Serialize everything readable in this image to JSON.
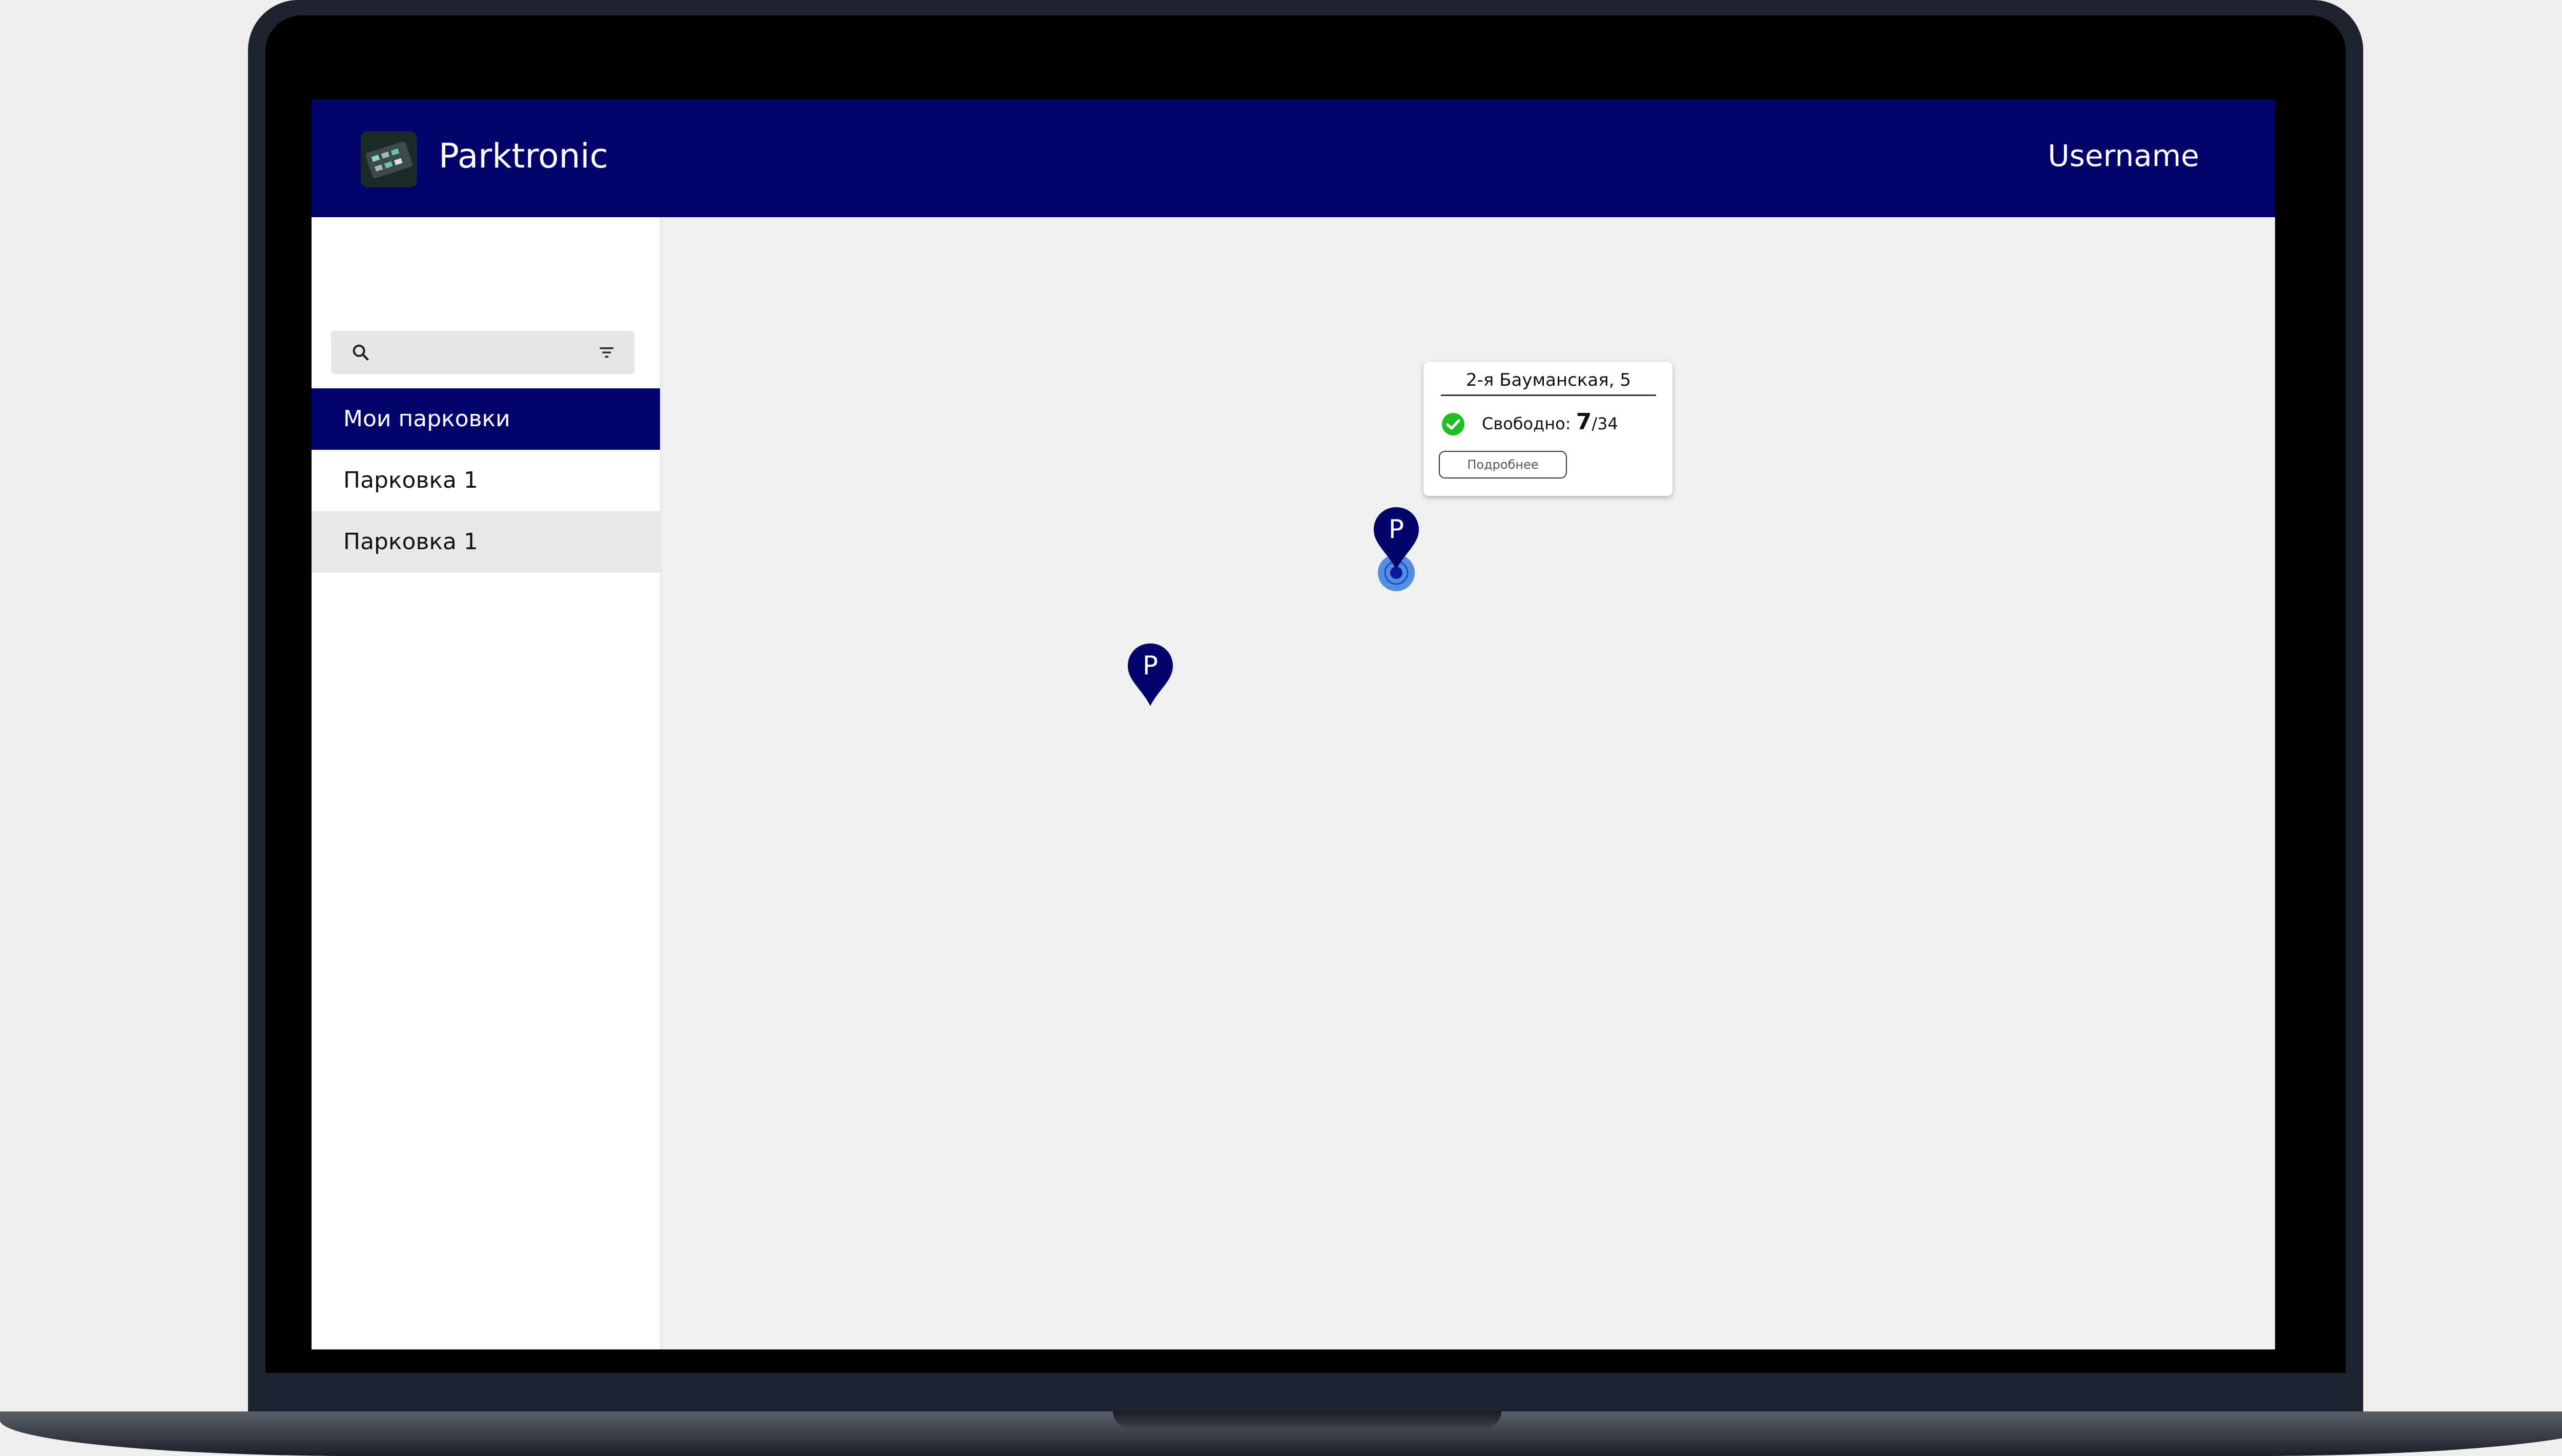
{
  "header": {
    "app_title": "Parktronic",
    "username": "Username"
  },
  "sidebar": {
    "search": {
      "placeholder": ""
    },
    "items": [
      {
        "label": "Мои парковки",
        "state": "active"
      },
      {
        "label": "Парковка 1",
        "state": "normal"
      },
      {
        "label": "Парковка 1",
        "state": "highlighted"
      }
    ]
  },
  "map": {
    "pins": [
      {
        "letter": "P",
        "selected": true
      },
      {
        "letter": "P",
        "selected": false
      }
    ],
    "popup": {
      "address": "2-я Бауманская, 5",
      "free_label": "Свободно:",
      "free_count": "7",
      "total": "/34",
      "details_button": "Подробнее"
    }
  },
  "colors": {
    "brand": "#03036b",
    "status_ok": "#1fbf24",
    "location": "#3a7be0"
  }
}
